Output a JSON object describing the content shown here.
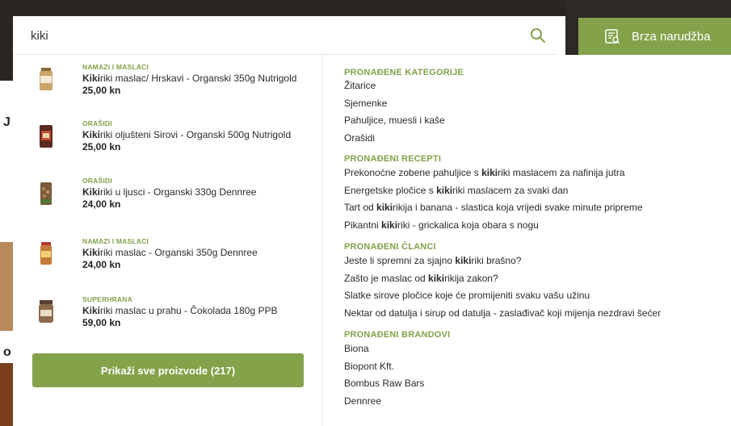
{
  "search": {
    "value": "kiki"
  },
  "quick_order": {
    "label": "Brza narudžba"
  },
  "products": [
    {
      "category": "NAMAZI I MASLACI",
      "name_pre": "",
      "name_bold": "Kiki",
      "name_post": "riki maslac/ Hrskavi - Organski 350g Nutrigold",
      "price": "25,00 kn"
    },
    {
      "category": "ORAŠIDI",
      "name_pre": "",
      "name_bold": "Kiki",
      "name_post": "riki oljušteni Sirovi - Organski 500g Nutrigold",
      "price": "25,00 kn"
    },
    {
      "category": "ORAŠIDI",
      "name_pre": "",
      "name_bold": "Kiki",
      "name_post": "riki u ljusci - Organski 330g Dennree",
      "price": "24,00 kn"
    },
    {
      "category": "NAMAZI I MASLACI",
      "name_pre": "",
      "name_bold": "Kiki",
      "name_post": "riki maslac - Organski 350g Dennree",
      "price": "24,00 kn"
    },
    {
      "category": "SUPERHRANA",
      "name_pre": "",
      "name_bold": "Kiki",
      "name_post": "riki maslac u prahu - Čokolada 180g PPB",
      "price": "59,00 kn"
    }
  ],
  "show_all": {
    "label": "Prikaži sve proizvode (217)"
  },
  "categories": {
    "title": "PRONAĐENE KATEGORIJE",
    "items": [
      "Žitarice",
      "Sjemenke",
      "Pahuljice, muesli i kaše",
      "Orašidi"
    ]
  },
  "recipes": {
    "title": "PRONAĐENI RECEPTI",
    "items": [
      {
        "pre": "Prekonoćne zobene pahuljice s ",
        "bold": "kiki",
        "post": "riki maslacem za nafinija jutra"
      },
      {
        "pre": "Energetske pločice s ",
        "bold": "kiki",
        "post": "riki maslacem za svaki dan"
      },
      {
        "pre": "Tart od ",
        "bold": "kiki",
        "post": "rikija i banana - slastica koja vrijedi svake minute pripreme"
      },
      {
        "pre": "Pikantni ",
        "bold": "kiki",
        "post": "riki - grickalica koja obara s nogu"
      }
    ]
  },
  "articles": {
    "title": "PRONAĐENI ČLANCI",
    "items": [
      {
        "pre": "Jeste li spremni za sjajno ",
        "bold": "kiki",
        "post": "riki brašno?"
      },
      {
        "pre": "Zašto je maslac od ",
        "bold": "kiki",
        "post": "rikija zakon?"
      },
      {
        "pre": "Slatke sirove pločice koje će promijeniti svaku vašu užinu",
        "bold": "",
        "post": ""
      },
      {
        "pre": "Nektar od datulja i sirup od datulja - zaslađivač koji mijenja nezdravi šećer",
        "bold": "",
        "post": ""
      }
    ]
  },
  "brands": {
    "title": "PRONAĐENI BRANDOVI",
    "items": [
      "Biona",
      "Biopont Kft.",
      "Bombus Raw Bars",
      "Dennree"
    ]
  },
  "backdrop": {
    "left_char_1": "J",
    "left_char_2": "o"
  },
  "colors": {
    "accent": "#84a24a",
    "text": "#2a2a2a",
    "dark_bg": "#2a2422"
  }
}
